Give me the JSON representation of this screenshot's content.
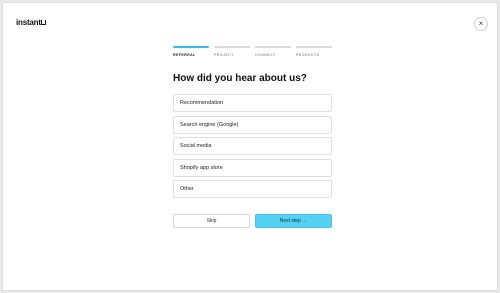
{
  "brand": {
    "logo_text": "instant",
    "logo_mark": "u"
  },
  "close_glyph": "×",
  "steps": [
    {
      "label": "REFERRAL",
      "active": true
    },
    {
      "label": "PROJECT",
      "active": false
    },
    {
      "label": "CONNECT",
      "active": false
    },
    {
      "label": "PRODUCTS",
      "active": false
    }
  ],
  "heading": "How did you hear about us?",
  "options": [
    "Recommendation",
    "Search engine (Google)",
    "Social media",
    "Shopify app store",
    "Other"
  ],
  "actions": {
    "skip_label": "Skip",
    "next_label": "Next step →"
  },
  "colors": {
    "accent": "#3bbbe6",
    "next_button": "#54d1f0"
  }
}
